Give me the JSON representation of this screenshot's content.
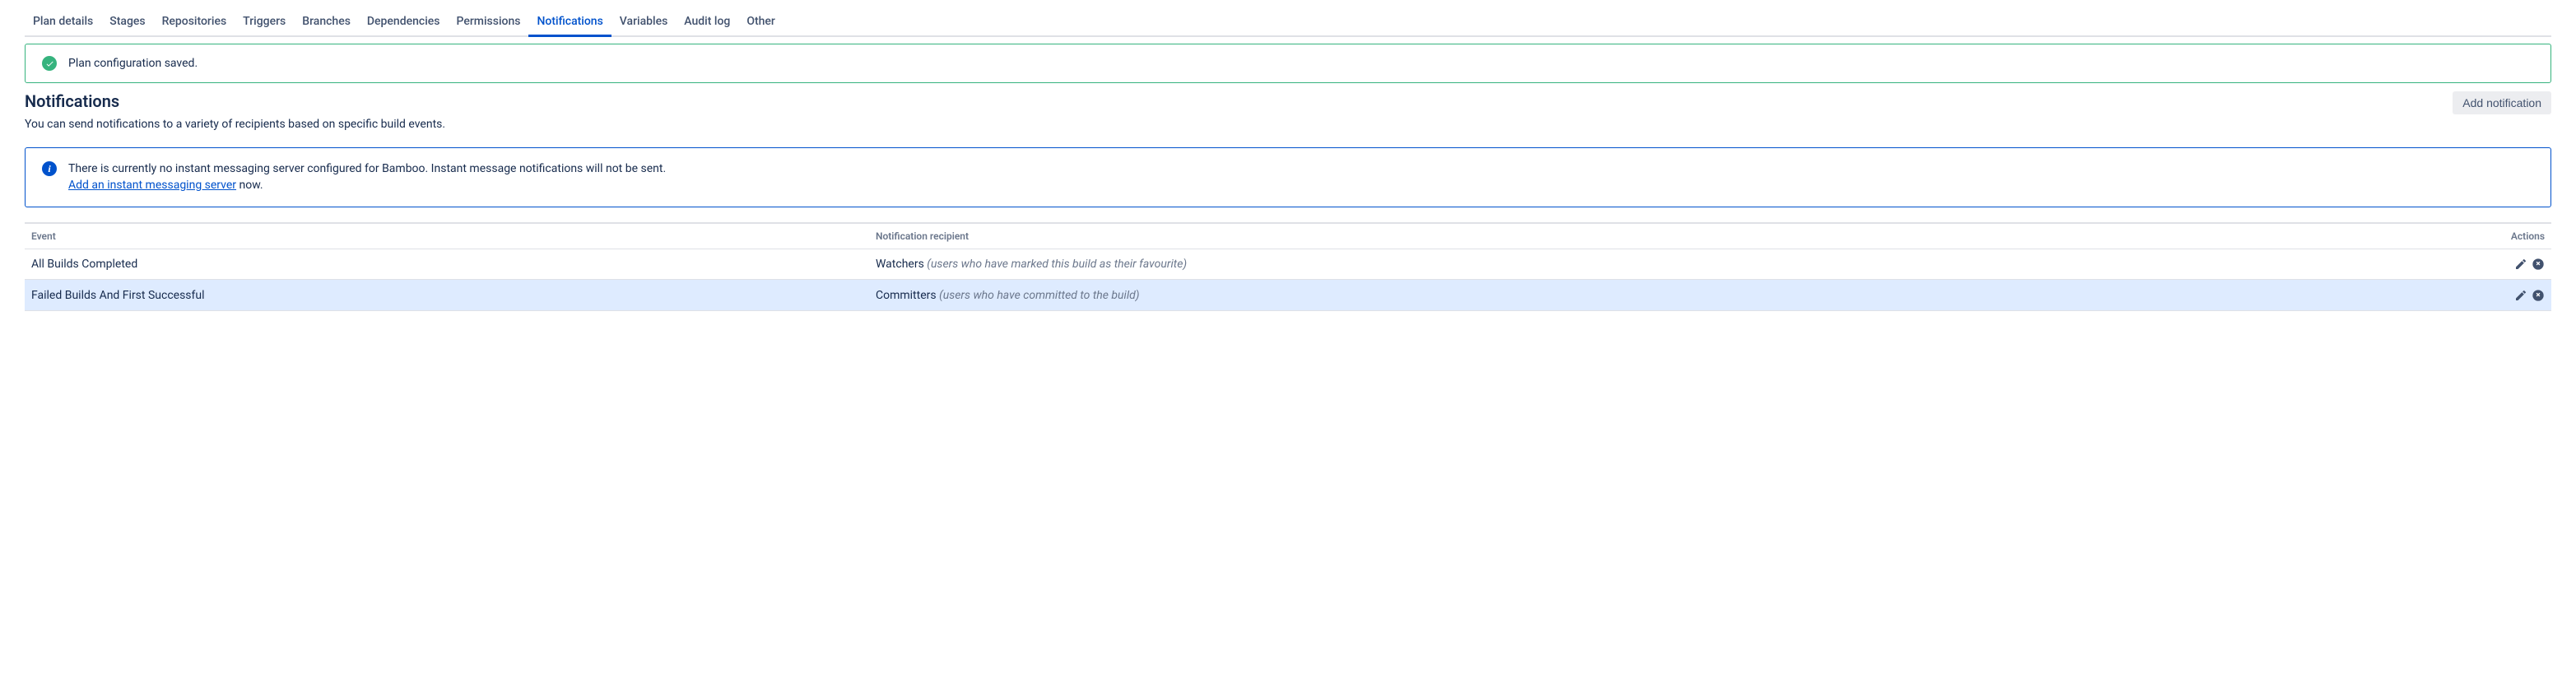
{
  "tabs": [
    {
      "label": "Plan details"
    },
    {
      "label": "Stages"
    },
    {
      "label": "Repositories"
    },
    {
      "label": "Triggers"
    },
    {
      "label": "Branches"
    },
    {
      "label": "Dependencies"
    },
    {
      "label": "Permissions"
    },
    {
      "label": "Notifications"
    },
    {
      "label": "Variables"
    },
    {
      "label": "Audit log"
    },
    {
      "label": "Other"
    }
  ],
  "success_message": "Plan configuration saved.",
  "page_title": "Notifications",
  "add_button_label": "Add notification",
  "description": "You can send notifications to a variety of recipients based on specific build events.",
  "info": {
    "text1": "There is currently no instant messaging server configured for Bamboo. Instant message notifications will not be sent.",
    "link_text": "Add an instant messaging server",
    "text2": " now."
  },
  "table": {
    "headers": {
      "event": "Event",
      "recipient": "Notification recipient",
      "actions": "Actions"
    },
    "rows": [
      {
        "event": "All Builds Completed",
        "recipient_name": "Watchers",
        "recipient_desc": "(users who have marked this build as their favourite)",
        "highlight": false
      },
      {
        "event": "Failed Builds And First Successful",
        "recipient_name": "Committers",
        "recipient_desc": "(users who have committed to the build)",
        "highlight": true
      }
    ]
  }
}
